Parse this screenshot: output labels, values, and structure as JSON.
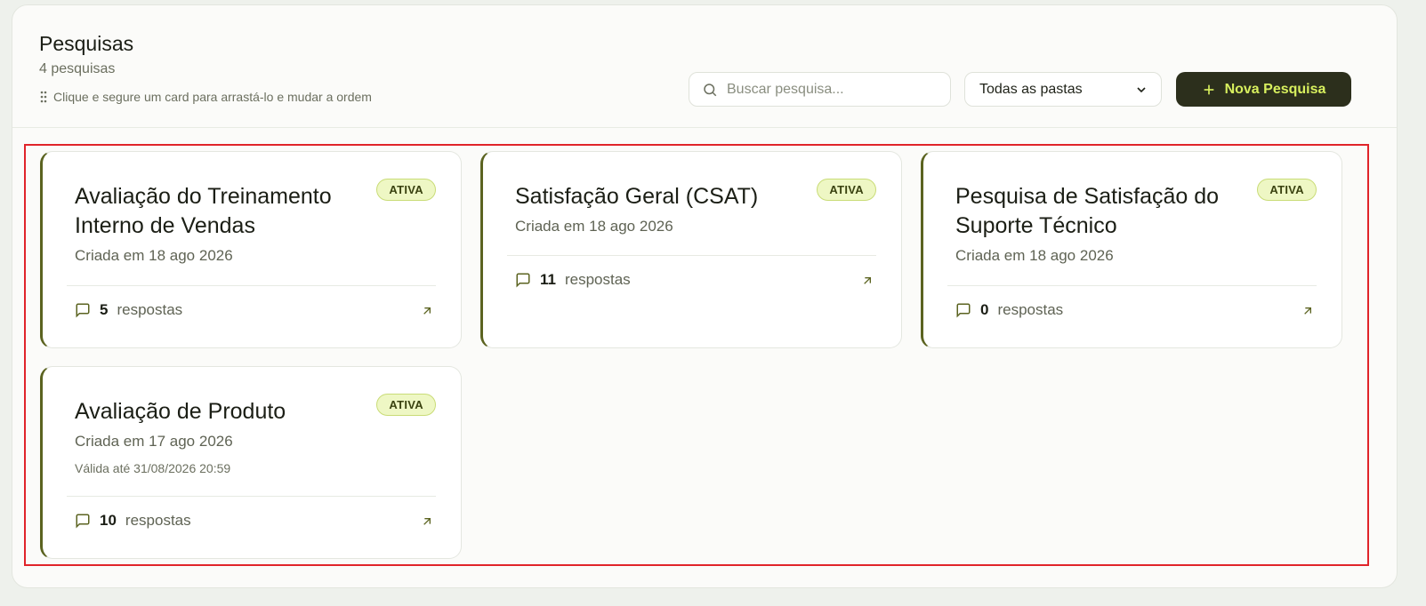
{
  "header": {
    "title": "Pesquisas",
    "count": "4 pesquisas",
    "hint": "Clique e segure um card para arrastá-lo e mudar a ordem"
  },
  "search": {
    "placeholder": "Buscar pesquisa...",
    "value": ""
  },
  "folder_filter": {
    "selected": "Todas as pastas"
  },
  "new_button": {
    "label": "Nova Pesquisa"
  },
  "colors": {
    "accent": "#5b6320",
    "button_bg": "#2c2f1c",
    "button_text": "#d7ef5e",
    "badge_bg": "#eef7c4"
  },
  "icons": {
    "drag": "drag-dots-icon",
    "search": "search-icon",
    "chevron": "chevron-down-icon",
    "plus": "plus-icon",
    "responses": "message-square-icon",
    "open": "arrow-up-right-icon"
  },
  "surveys": [
    {
      "title": "Avaliação do Treinamento Interno de Vendas",
      "status": "ATIVA",
      "created": "Criada em 18 ago 2026",
      "responses": "5",
      "responses_label": "respostas"
    },
    {
      "title": "Satisfação Geral (CSAT)",
      "status": "ATIVA",
      "created": "Criada em 18 ago 2026",
      "responses": "11",
      "responses_label": "respostas"
    },
    {
      "title": "Pesquisa de Satisfação do Suporte Técnico",
      "status": "ATIVA",
      "created": "Criada em 18 ago 2026",
      "responses": "0",
      "responses_label": "respostas"
    },
    {
      "title": "Avaliação de Produto",
      "status": "ATIVA",
      "created": "Criada em 17 ago 2026",
      "valid_until": "Válida até 31/08/2026 20:59",
      "responses": "10",
      "responses_label": "respostas"
    }
  ]
}
